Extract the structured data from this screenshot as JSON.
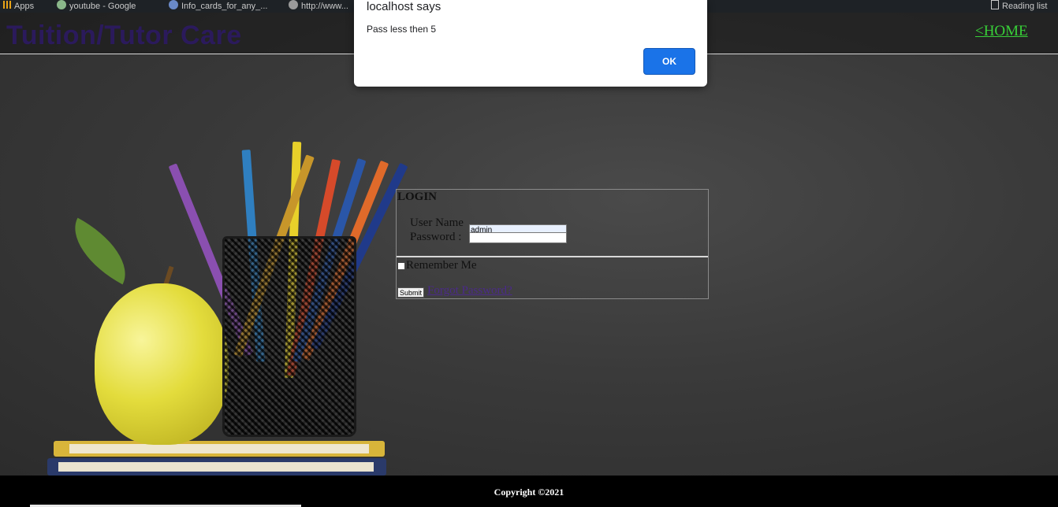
{
  "browser": {
    "bookmarks": [
      {
        "label": "Apps",
        "icon": "apps-grid-icon"
      },
      {
        "label": "youtube - Google",
        "icon": "site-icon"
      },
      {
        "label": "Info_cards_for_any_...",
        "icon": "site-icon"
      },
      {
        "label": "http://www...",
        "icon": "site-icon"
      },
      {
        "label": "Reading list",
        "icon": "reading-list-icon"
      }
    ]
  },
  "header": {
    "title": "Tuition/Tutor Care",
    "home_link": "<HOME"
  },
  "login": {
    "title": "LOGIN",
    "username_label": "User Name :",
    "username_value": "admin",
    "password_label": "Password   :",
    "password_value": "",
    "remember_label": "Remember Me",
    "remember_checked": false,
    "submit_label": "Submit",
    "forgot_label": "Forgot Password?"
  },
  "footer": {
    "copyright": "Copyright ©2021"
  },
  "alert": {
    "title": "localhost says",
    "message": "Pass less then 5",
    "ok_label": "OK"
  },
  "colors": {
    "title": "#2b1a5c",
    "home_link": "#38d038",
    "alert_button": "#1a73e8",
    "forgot_link": "#4b2a8a"
  }
}
